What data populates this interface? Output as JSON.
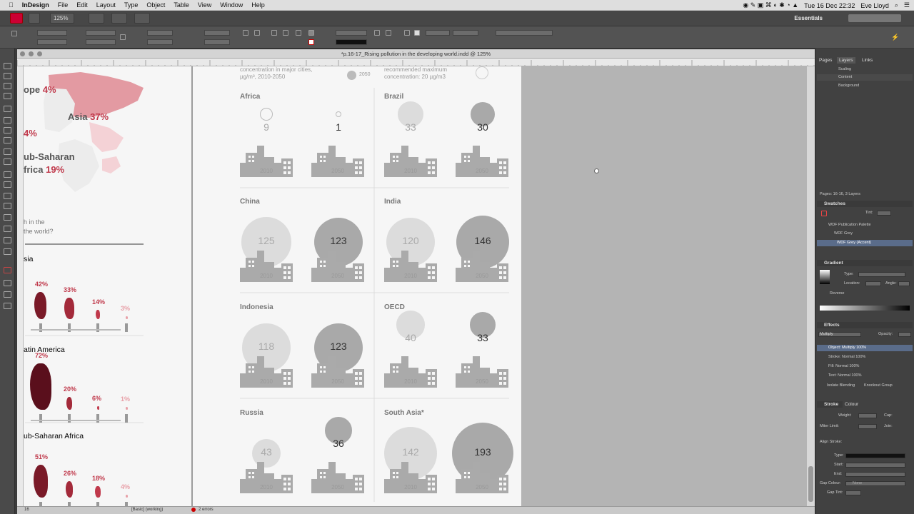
{
  "menubar": {
    "apple": "",
    "app": "InDesign",
    "items": [
      "File",
      "Edit",
      "Layout",
      "Type",
      "Object",
      "Table",
      "View",
      "Window",
      "Help"
    ],
    "clock": "Tue 16 Dec  22:32",
    "user": "Eve Lloyd"
  },
  "appbar": {
    "zoom": "125%",
    "workspace": "Essentials"
  },
  "document": {
    "title": "*p.16-17_Rising pollution in the developing world.indd @ 125%"
  },
  "left_page": {
    "map_labels": [
      {
        "name": "ope",
        "pct": "4%"
      },
      {
        "name": "Asia",
        "pct": "37%"
      },
      {
        "name": "",
        "pct": "4%"
      },
      {
        "name": "ub-Saharan",
        "pct": ""
      },
      {
        "name": "frica",
        "pct": "19%"
      }
    ],
    "question": [
      "h in the",
      "the world?"
    ],
    "regions": [
      {
        "name": "sia",
        "values": [
          "42%",
          "33%",
          "14%",
          "3%"
        ]
      },
      {
        "name": "atin America",
        "values": [
          "72%",
          "20%",
          "6%",
          "1%"
        ]
      },
      {
        "name": "ub-Saharan Africa",
        "values": [
          "51%",
          "26%",
          "18%",
          "4%"
        ]
      }
    ]
  },
  "right_page": {
    "header_left": [
      "concentration in major cities,",
      "µg/m³, 2010-2050"
    ],
    "legend_year": "2050",
    "header_right": [
      "recommended maximum",
      "concentration: 20 µg/m3"
    ],
    "countries": [
      {
        "name": "Africa",
        "v2010": "9",
        "v2050": "1"
      },
      {
        "name": "Brazil",
        "v2010": "33",
        "v2050": "30"
      },
      {
        "name": "China",
        "v2010": "125",
        "v2050": "123"
      },
      {
        "name": "India",
        "v2010": "120",
        "v2050": "146"
      },
      {
        "name": "Indonesia",
        "v2010": "118",
        "v2050": "123"
      },
      {
        "name": "OECD",
        "v2010": "40",
        "v2050": "33"
      },
      {
        "name": "Russia",
        "v2010": "43",
        "v2050": "36"
      },
      {
        "name": "South Asia*",
        "v2010": "142",
        "v2050": "193"
      }
    ],
    "year_a": "2010",
    "year_b": "2050"
  },
  "panels": {
    "tabs": [
      "Pages",
      "Layers",
      "Links"
    ],
    "layers": [
      "Scaling",
      "Content",
      "Background"
    ],
    "layers_status": "Pages: 16-16, 3 Layers",
    "swatches": {
      "title": "Swatches",
      "tint_label": "Tint:",
      "items": [
        "WDF Publication Palette",
        "WDF Grey",
        "WDF Grey (Accent)"
      ]
    },
    "gradient": {
      "title": "Gradient",
      "type": "Type:",
      "location": "Location:",
      "angle": "Angle:",
      "reverse": "Reverse"
    },
    "effects": {
      "title": "Effects",
      "mode": "Multiply",
      "opacity": "Opacity:",
      "rows": [
        "Object: Multiply 100%",
        "Stroke: Normal 100%",
        "Fill: Normal 100%",
        "Text: Normal 100%"
      ],
      "isolate": "Isolate Blending",
      "knockout": "Knockout Group"
    },
    "stroke": {
      "title": "Stroke",
      "colour": "Colour",
      "weight": "Weight:",
      "cap": "Cap:",
      "miter": "Miter Limit:",
      "join": "Join:",
      "align": "Align Stroke:",
      "type": "Type:",
      "start": "Start:",
      "end": "End:",
      "gap_colour": "Gap Colour:",
      "gap_tint": "Gap Tint:",
      "none": "None"
    }
  },
  "statusbar": {
    "page": "16",
    "style": "[Basic] (working)",
    "errors": "2 errors"
  }
}
